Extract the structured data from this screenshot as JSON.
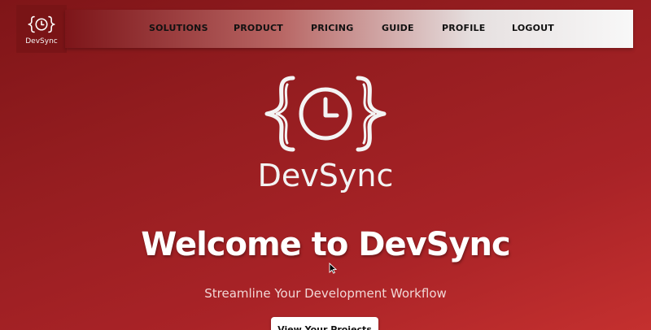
{
  "brand": {
    "name": "DevSync"
  },
  "nav": {
    "items": [
      {
        "label": "SOLUTIONS"
      },
      {
        "label": "PRODUCT"
      },
      {
        "label": "PRICING"
      },
      {
        "label": "GUIDE"
      },
      {
        "label": "PROFILE"
      },
      {
        "label": "LOGOUT"
      }
    ]
  },
  "hero": {
    "logo_icon": "brackets-clock-icon",
    "brand_text": "DevSync",
    "title": "Welcome to DevSync",
    "subtitle": "Streamline Your Development Workflow",
    "cta_label": "View Your Projects"
  },
  "colors": {
    "background_dark": "#7f1518",
    "background_light": "#c4302f",
    "text_light": "#ffffff",
    "nav_text": "#111111"
  }
}
